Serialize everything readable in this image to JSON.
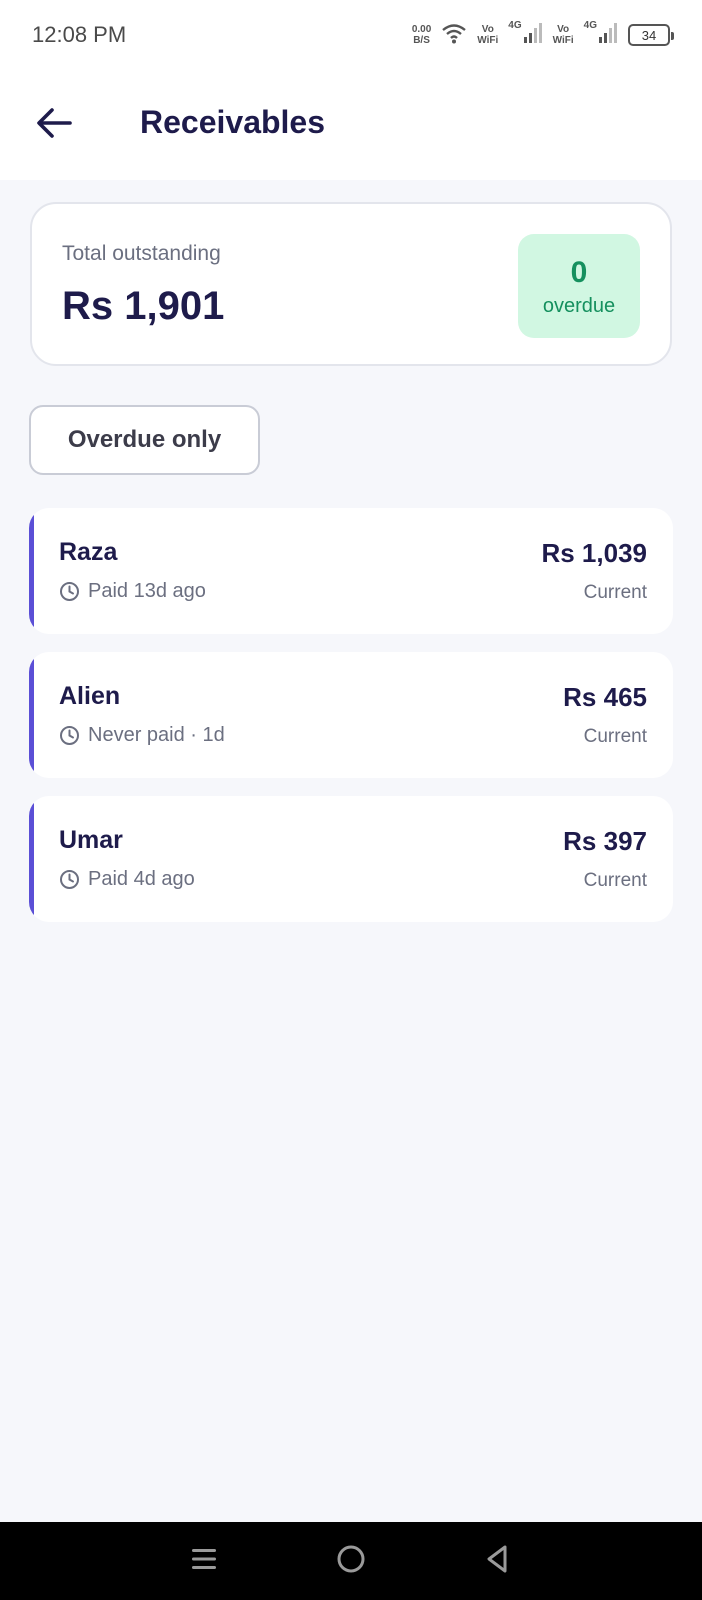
{
  "status_bar": {
    "time": "12:08 PM",
    "net_speed_value": "0.00",
    "net_speed_unit": "B/S",
    "vowifi_1_top": "Vo",
    "vowifi_1_bottom": "WiFi",
    "signal_1_label": "4G",
    "vowifi_2_top": "Vo",
    "vowifi_2_bottom": "WiFi",
    "signal_2_label": "4G",
    "battery": "34"
  },
  "header": {
    "title": "Receivables",
    "back_icon": "arrow-left-icon"
  },
  "summary": {
    "label": "Total outstanding",
    "amount": "Rs 1,901",
    "overdue_count": "0",
    "overdue_label": "overdue"
  },
  "filter": {
    "label": "Overdue only"
  },
  "receivables": [
    {
      "name": "Raza",
      "meta": "Paid 13d ago",
      "amount": "Rs 1,039",
      "status": "Current"
    },
    {
      "name": "Alien",
      "meta": "Never paid · 1d",
      "amount": "Rs 465",
      "status": "Current"
    },
    {
      "name": "Umar",
      "meta": "Paid 4d ago",
      "amount": "Rs 397",
      "status": "Current"
    }
  ],
  "colors": {
    "accent": "#5b4fd6",
    "title": "#1e1b4b",
    "overdue_bg": "#d1f7e2",
    "overdue_text": "#15905e",
    "background": "#f6f7fb"
  },
  "nav": {
    "menu_icon": "menu-icon",
    "home_icon": "home-circle-icon",
    "back_icon": "back-triangle-icon"
  }
}
